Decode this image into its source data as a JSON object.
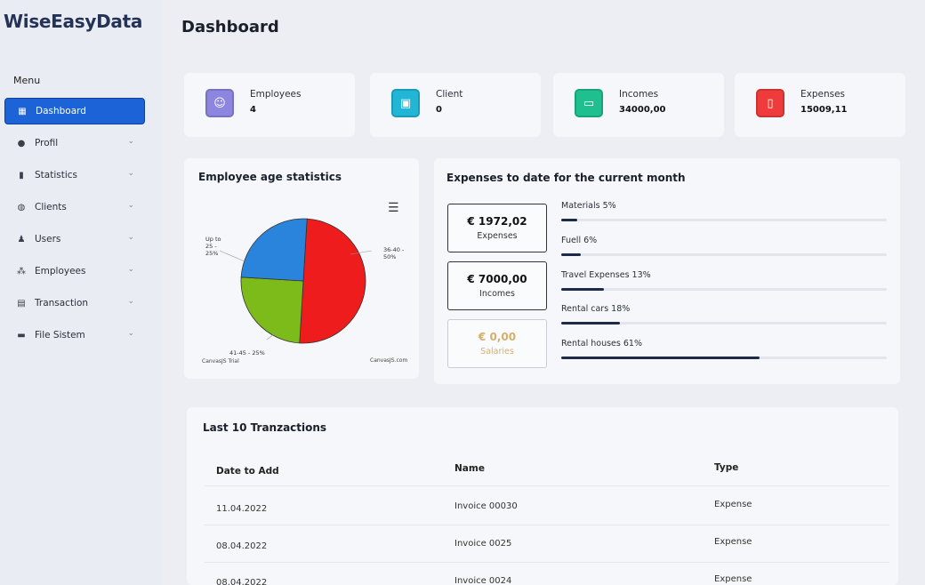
{
  "app": {
    "logo": "WiseEasyData",
    "menu_label": "Menu"
  },
  "sidebar": {
    "items": [
      {
        "label": "Dashboard",
        "icon": "grid-icon",
        "active": true
      },
      {
        "label": "Profil",
        "icon": "user-icon"
      },
      {
        "label": "Statistics",
        "icon": "bar-chart-icon"
      },
      {
        "label": "Clients",
        "icon": "globe-icon"
      },
      {
        "label": "Users",
        "icon": "users-icon"
      },
      {
        "label": "Employees",
        "icon": "people-icon"
      },
      {
        "label": "Transaction",
        "icon": "list-icon"
      },
      {
        "label": "File Sistem",
        "icon": "archive-icon"
      }
    ]
  },
  "header": {
    "title": "Dashboard"
  },
  "stats": [
    {
      "label": "Employees",
      "value": "4",
      "color": "#8c86e0",
      "icon": "employees-icon"
    },
    {
      "label": "Client",
      "value": "0",
      "color": "#22b6d6",
      "icon": "briefcase-icon"
    },
    {
      "label": "Incomes",
      "value": "34000,00",
      "color": "#1fbf8f",
      "icon": "wallet-icon"
    },
    {
      "label": "Expenses",
      "value": "15009,11",
      "color": "#ef3b3b",
      "icon": "receipt-icon"
    }
  ],
  "age_chart": {
    "title": "Employee age statistics",
    "credit_left": "CanvasJS Trial",
    "credit_right": "CanvasJS.com",
    "chart_data": {
      "type": "pie",
      "categories": [
        "36-40",
        "41-45",
        "Up to 25"
      ],
      "values": [
        50,
        25,
        25
      ],
      "labels": [
        "36-40 - 50%",
        "41-45 - 25%",
        "Up to 25 - 25%"
      ],
      "colors": [
        "#ee1c1c",
        "#7cbb1a",
        "#2a84dc"
      ]
    }
  },
  "expenses_month": {
    "title": "Expenses to date for the current month",
    "boxes": [
      {
        "value": "€ 1972,02",
        "caption": "Expenses"
      },
      {
        "value": "€ 7000,00",
        "caption": "Incomes"
      },
      {
        "value": "€ 0,00",
        "caption": "Salaries"
      }
    ],
    "progress": [
      {
        "label": "Materials 5%",
        "value": 5
      },
      {
        "label": "Fuell 6%",
        "value": 6
      },
      {
        "label": "Travel Expenses 13%",
        "value": 13
      },
      {
        "label": "Rental cars 18%",
        "value": 18
      },
      {
        "label": "Rental houses 61%",
        "value": 61
      }
    ]
  },
  "transactions": {
    "title": "Last 10 Tranzactions",
    "columns": [
      "Date to Add",
      "Name",
      "Type"
    ],
    "rows": [
      [
        "11.04.2022",
        "Invoice 00030",
        "Expense"
      ],
      [
        "08.04.2022",
        "Invoice 0025",
        "Expense"
      ],
      [
        "08.04.2022",
        "Invoice 0024",
        "Expense"
      ]
    ]
  }
}
